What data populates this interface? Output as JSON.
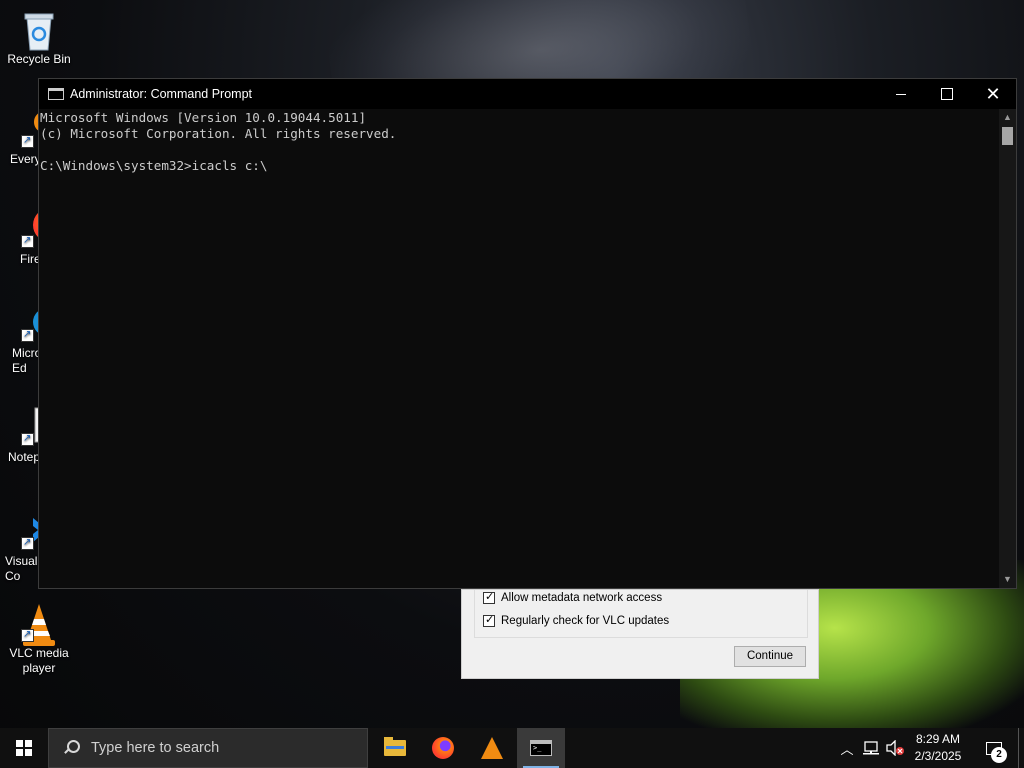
{
  "desktop": {
    "icons": [
      {
        "label": "Recycle Bin",
        "icon": "recycle-bin-icon"
      },
      {
        "label": "Every",
        "icon": "everything-search-icon"
      },
      {
        "label": "Fire",
        "icon": "firefox-icon"
      },
      {
        "label": "Micro Ed",
        "icon": "edge-icon"
      },
      {
        "label": "Notep",
        "icon": "notepad-plus-plus-icon"
      },
      {
        "label": "Visual Co",
        "icon": "vscode-icon"
      },
      {
        "label": "VLC media player",
        "icon": "vlc-icon"
      }
    ]
  },
  "cmd": {
    "title": "Administrator: Command Prompt",
    "lines": [
      "Microsoft Windows [Version 10.0.19044.5011]",
      "(c) Microsoft Corporation. All rights reserved.",
      "",
      "C:\\Windows\\system32>icacls c:\\"
    ],
    "colors": {
      "background": "#0c0c0c",
      "text": "#cccccc"
    }
  },
  "vlc_dialog": {
    "checkboxes": [
      {
        "label": "Allow metadata network access",
        "checked": true
      },
      {
        "label": "Regularly check for VLC updates",
        "checked": true
      }
    ],
    "continue_label": "Continue"
  },
  "taskbar": {
    "search_placeholder": "Type here to search",
    "pinned": [
      "file-explorer-icon",
      "firefox-icon",
      "vlc-icon",
      "command-prompt-icon"
    ],
    "clock_time": "8:29 AM",
    "clock_date": "2/3/2025",
    "notification_count": "2"
  }
}
